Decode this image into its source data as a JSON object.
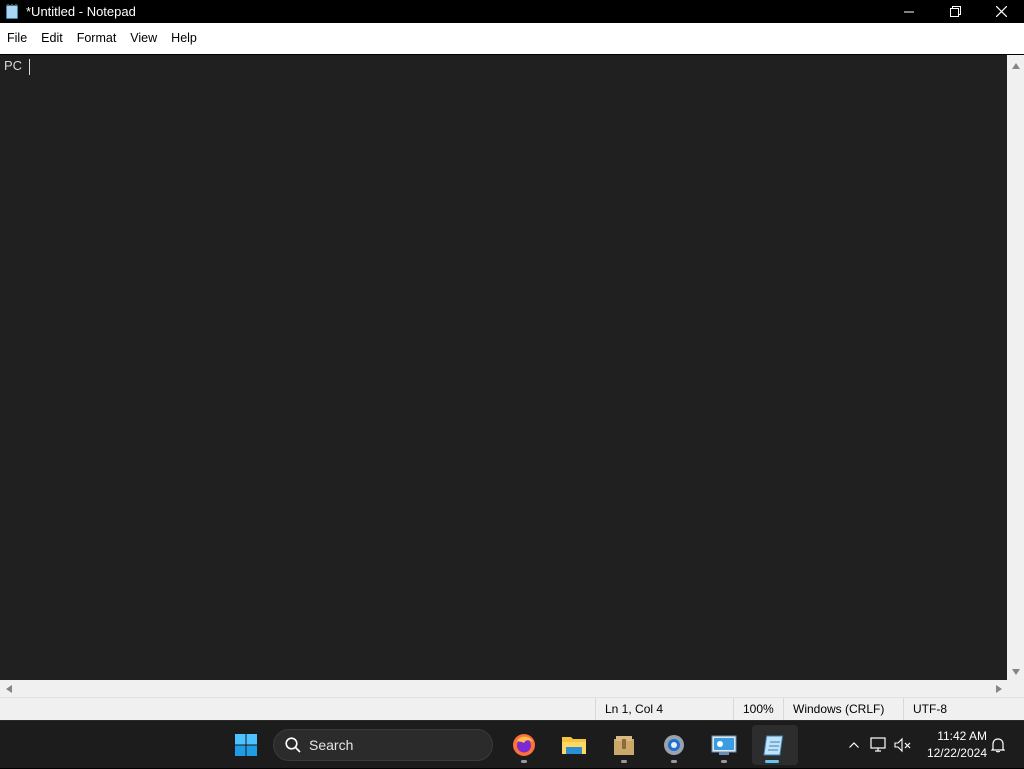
{
  "window": {
    "title": "*Untitled - Notepad",
    "controls": {
      "minimize": "minimize-icon",
      "maximize": "restore-icon",
      "close": "close-icon"
    }
  },
  "menu": {
    "items": [
      "File",
      "Edit",
      "Format",
      "View",
      "Help"
    ]
  },
  "editor": {
    "content": "PC ",
    "background": "#202020"
  },
  "status": {
    "position": "Ln 1, Col 4",
    "zoom": "100%",
    "line_ending": "Windows (CRLF)",
    "encoding": "UTF-8"
  },
  "taskbar": {
    "search_label": "Search",
    "apps": [
      "start-icon",
      "firefox-icon",
      "file-explorer-icon",
      "archive-icon",
      "settings-icon",
      "control-panel-icon",
      "notepad-icon"
    ],
    "clock": {
      "time": "11:42 AM",
      "date": "12/22/2024"
    },
    "accent": "#5fc8ee"
  }
}
